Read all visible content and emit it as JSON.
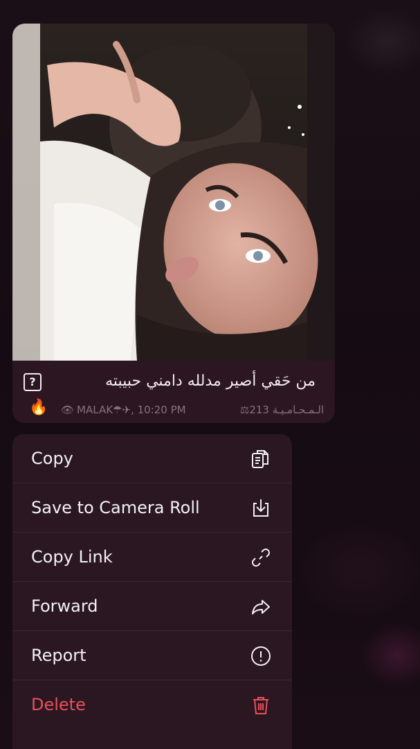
{
  "message": {
    "caption": "من حَقي أصير مدلله دامني حبيبته",
    "caption_end_icon": "question-box-icon",
    "reaction_emoji": "🔥",
    "meta_sender": "MALAK☂✈, 10:20 PM",
    "meta_channel": "⚖الـمـحـامـيـة 213",
    "views_icon": "eye-icon"
  },
  "menu": {
    "items": [
      {
        "label": "Copy",
        "icon": "copy-icon"
      },
      {
        "label": "Save to Camera Roll",
        "icon": "save-download-icon"
      },
      {
        "label": "Copy Link",
        "icon": "link-icon"
      },
      {
        "label": "Forward",
        "icon": "forward-arrow-icon"
      },
      {
        "label": "Report",
        "icon": "report-exclamation-icon"
      },
      {
        "label": "Delete",
        "icon": "trash-icon"
      }
    ]
  },
  "colors": {
    "background": "#150b12",
    "bubble": "#2b1621",
    "menu": "#2c1822",
    "delete": "#e8505b",
    "text": "#f2f2f4"
  }
}
